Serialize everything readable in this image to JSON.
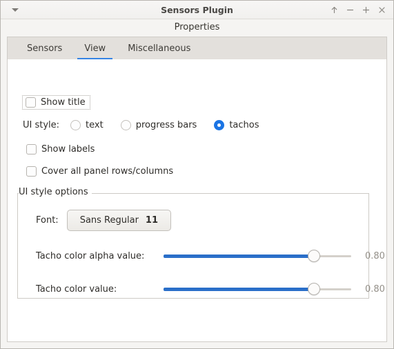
{
  "window": {
    "title": "Sensors Plugin",
    "menu_icon": "triangle-down-icon",
    "buttons": [
      {
        "name": "shade-button",
        "icon": "arrow-up-icon"
      },
      {
        "name": "minimize-button",
        "icon": "minus-icon"
      },
      {
        "name": "maximize-button",
        "icon": "plus-icon"
      },
      {
        "name": "close-button",
        "icon": "close-icon"
      }
    ]
  },
  "dialog": {
    "header": "Properties"
  },
  "tabs": [
    {
      "label": "Sensors",
      "active": false
    },
    {
      "label": "View",
      "active": true
    },
    {
      "label": "Miscellaneous",
      "active": false
    }
  ],
  "view_tab": {
    "show_title": {
      "label": "Show title",
      "checked": false,
      "focused": true
    },
    "ui_style": {
      "label": "UI style:",
      "options": [
        {
          "label": "text",
          "selected": false
        },
        {
          "label": "progress bars",
          "selected": false
        },
        {
          "label": "tachos",
          "selected": true
        }
      ]
    },
    "show_labels": {
      "label": "Show labels",
      "checked": false
    },
    "cover_all_panel": {
      "label": "Cover all panel rows/columns",
      "checked": false
    },
    "ui_style_options": {
      "title": "UI style options",
      "font": {
        "label": "Font:",
        "family": "Sans Regular",
        "size": "11"
      },
      "sliders": [
        {
          "label": "Tacho color alpha value:",
          "value": "0.80",
          "fraction": 0.8
        },
        {
          "label": "Tacho color value:",
          "value": "0.80",
          "fraction": 0.8
        }
      ]
    }
  },
  "colors": {
    "accent": "#3584e4",
    "slider_fill": "#2a6fc9",
    "radio_selected": "#1b74e4",
    "tabbar_bg": "#e3e0dc",
    "window_bg": "#f5f4f2"
  }
}
